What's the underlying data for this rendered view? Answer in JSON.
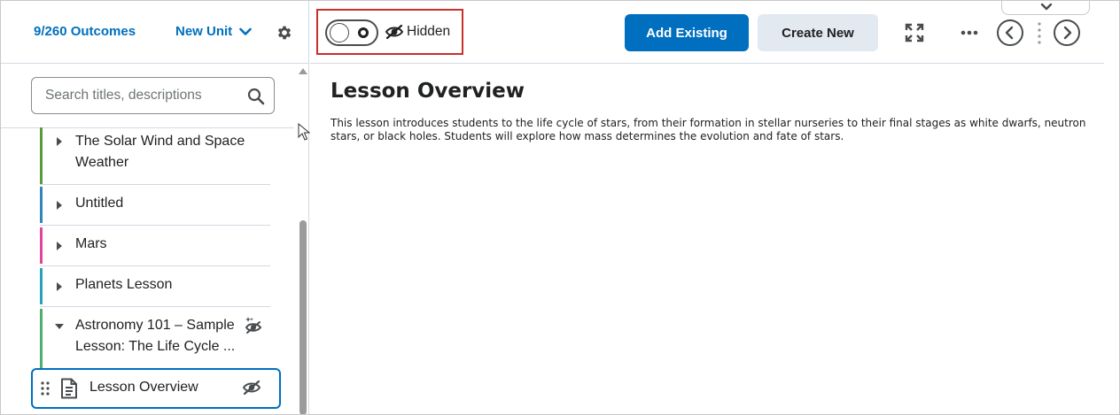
{
  "sidebar": {
    "outcomes_label": "9/260 Outcomes",
    "new_unit_label": "New Unit",
    "search_placeholder": "Search titles, descriptions",
    "items": [
      {
        "label_line1": "The Solar Wind and Space",
        "label_line2": "Weather",
        "color": "#5b9a3a",
        "expanded": false
      },
      {
        "label_line1": "Untitled",
        "color": "#2f86b8",
        "expanded": false
      },
      {
        "label_line1": "Mars",
        "color": "#e0459b",
        "expanded": false
      },
      {
        "label_line1": "Planets Lesson",
        "color": "#2aa0b7",
        "expanded": false
      },
      {
        "label_line1": "Astronomy 101 – Sample",
        "label_line2": "Lesson: The Life Cycle ...",
        "color": "#4caf6e",
        "expanded": true
      }
    ],
    "selected_item": {
      "label": "Lesson Overview"
    }
  },
  "toolbar": {
    "visibility_label": "Hidden",
    "add_existing_label": "Add Existing",
    "create_new_label": "Create New"
  },
  "content": {
    "title": "Lesson Overview",
    "body": "This lesson introduces students to the life cycle of stars, from their formation in stellar nurseries to their final stages as white dwarfs, neutron stars, or black holes. Students will explore how mass determines the evolution and fate of stars."
  },
  "colors": {
    "accent": "#006fbf",
    "highlight_box": "#c8302c"
  }
}
